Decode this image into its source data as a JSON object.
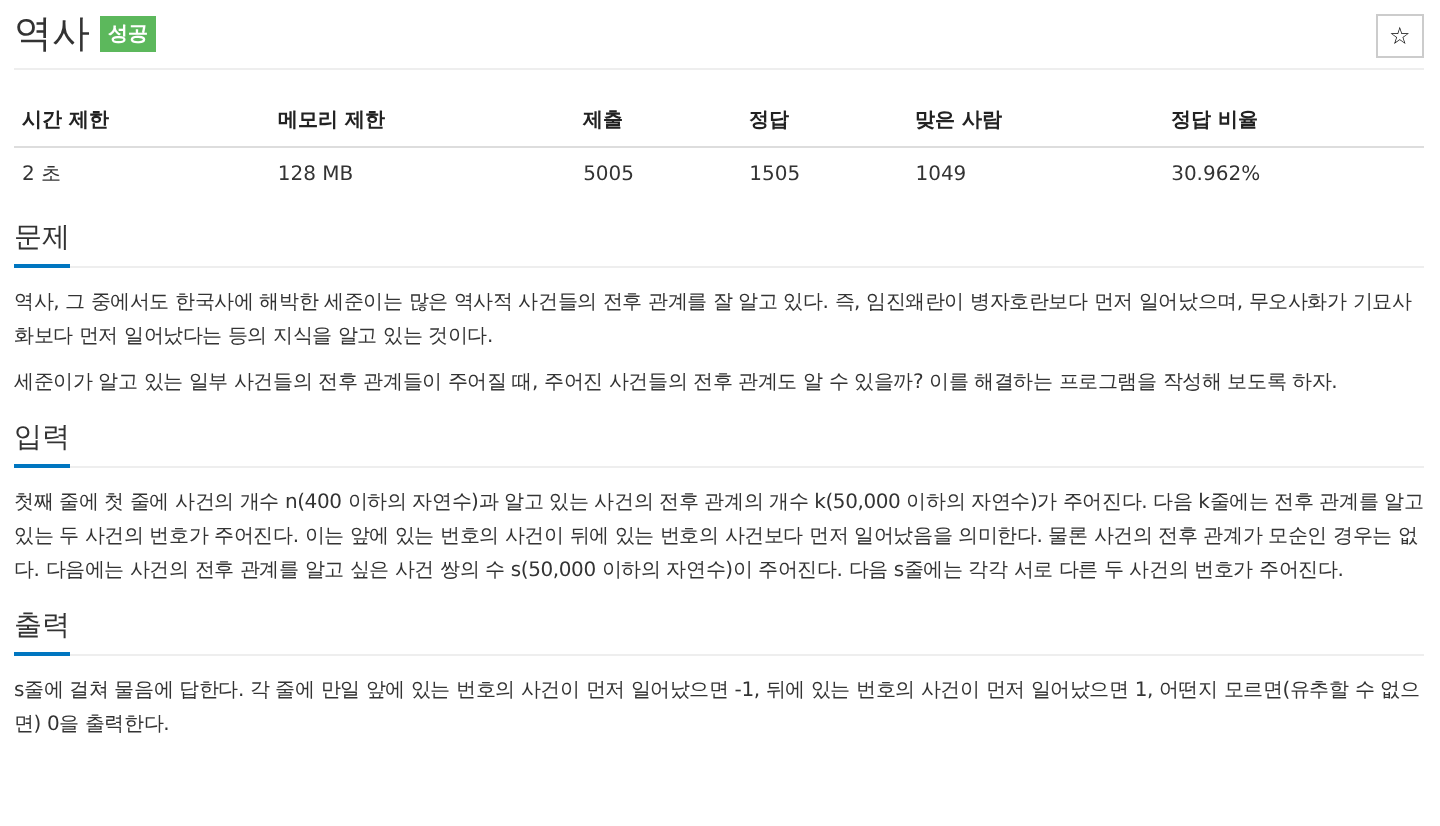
{
  "title": "역사",
  "badge": "성공",
  "star_button": "☆",
  "table": {
    "columns": [
      "시간 제한",
      "메모리 제한",
      "제출",
      "정답",
      "맞은 사람",
      "정답 비율"
    ],
    "rows": [
      [
        "2 초",
        "128 MB",
        "5005",
        "1505",
        "1049",
        "30.962%"
      ]
    ]
  },
  "sections": [
    {
      "heading": "문제",
      "paragraphs": [
        "역사, 그 중에서도 한국사에 해박한 세준이는 많은 역사적 사건들의 전후 관계를 잘 알고 있다. 즉, 임진왜란이 병자호란보다 먼저 일어났으며, 무오사화가 기묘사화보다 먼저 일어났다는 등의 지식을 알고 있는 것이다.",
        "세준이가 알고 있는 일부 사건들의 전후 관계들이 주어질 때, 주어진 사건들의 전후 관계도 알 수 있을까? 이를 해결하는 프로그램을 작성해 보도록 하자."
      ]
    },
    {
      "heading": "입력",
      "paragraphs": [
        "첫째 줄에 첫 줄에 사건의 개수 n(400 이하의 자연수)과 알고 있는 사건의 전후 관계의 개수 k(50,000 이하의 자연수)가 주어진다. 다음 k줄에는 전후 관계를 알고 있는 두 사건의 번호가 주어진다. 이는 앞에 있는 번호의 사건이 뒤에 있는 번호의 사건보다 먼저 일어났음을 의미한다. 물론 사건의 전후 관계가 모순인 경우는 없다. 다음에는 사건의 전후 관계를 알고 싶은 사건 쌍의 수 s(50,000 이하의 자연수)이 주어진다. 다음 s줄에는 각각 서로 다른 두 사건의 번호가 주어진다."
      ]
    },
    {
      "heading": "출력",
      "paragraphs": [
        "s줄에 걸쳐 물음에 답한다. 각 줄에 만일 앞에 있는 번호의 사건이 먼저 일어났으면 -1, 뒤에 있는 번호의 사건이 먼저 일어났으면 1, 어떤지 모르면(유추할 수 없으면) 0을 출력한다."
      ]
    }
  ]
}
